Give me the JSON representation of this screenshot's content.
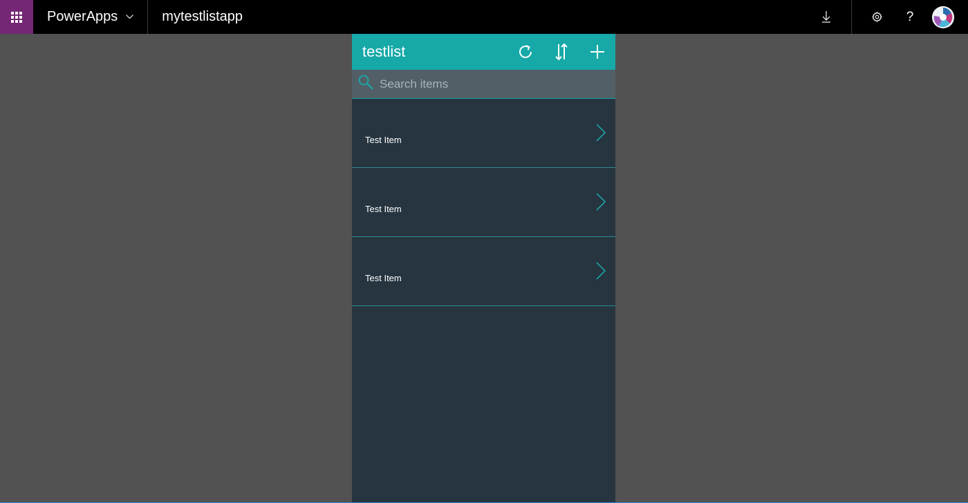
{
  "topbar": {
    "brand": "PowerApps",
    "app_name": "mytestlistapp",
    "icons": [
      "waffle-icon",
      "chevron-down-icon",
      "download-icon",
      "gear-icon",
      "help-icon",
      "avatar"
    ],
    "help_glyph": "?"
  },
  "app": {
    "title": "testlist",
    "header_actions": [
      "refresh-icon",
      "sort-icon",
      "add-icon"
    ],
    "search": {
      "placeholder": "Search items",
      "value": ""
    },
    "items": [
      {
        "title": "Test Item"
      },
      {
        "title": "Test Item"
      },
      {
        "title": "Test Item"
      }
    ]
  },
  "colors": {
    "topbar": "#000000",
    "waffle": "#742774",
    "background": "#525252",
    "app_header": "#17a9a8",
    "app_body": "#263540",
    "search_bg": "#535f67",
    "accent": "#1ea3a3"
  }
}
